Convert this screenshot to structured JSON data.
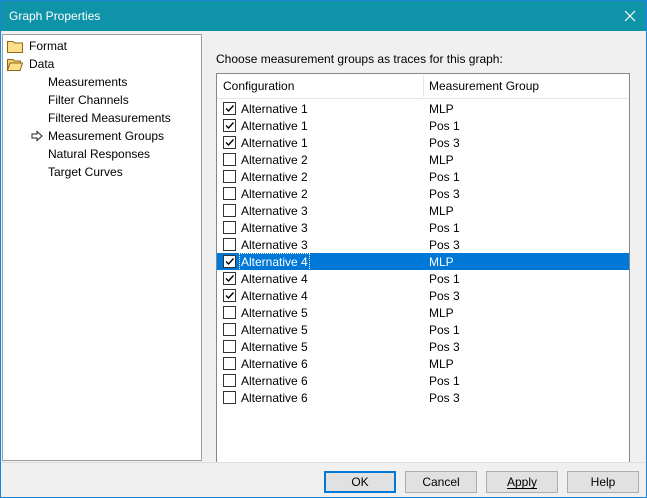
{
  "window": {
    "title": "Graph Properties"
  },
  "tree": {
    "items": [
      {
        "label": "Format",
        "icon": "folder-icon",
        "level": 0
      },
      {
        "label": "Data",
        "icon": "folder-open-icon",
        "level": 0
      },
      {
        "label": "Measurements",
        "level": 1
      },
      {
        "label": "Filter Channels",
        "level": 1
      },
      {
        "label": "Filtered Measurements",
        "level": 1
      },
      {
        "label": "Measurement Groups",
        "level": 1,
        "selected": true
      },
      {
        "label": "Natural Responses",
        "level": 1
      },
      {
        "label": "Target Curves",
        "level": 1
      }
    ]
  },
  "panel": {
    "prompt": "Choose measurement groups as traces for this graph:",
    "columns": [
      "Configuration",
      "Measurement Group"
    ],
    "rows": [
      {
        "config": "Alternative 1",
        "group": "MLP",
        "checked": true
      },
      {
        "config": "Alternative 1",
        "group": "Pos 1",
        "checked": true
      },
      {
        "config": "Alternative 1",
        "group": "Pos 3",
        "checked": true
      },
      {
        "config": "Alternative 2",
        "group": "MLP",
        "checked": false
      },
      {
        "config": "Alternative 2",
        "group": "Pos 1",
        "checked": false
      },
      {
        "config": "Alternative 2",
        "group": "Pos 3",
        "checked": false
      },
      {
        "config": "Alternative 3",
        "group": "MLP",
        "checked": false
      },
      {
        "config": "Alternative 3",
        "group": "Pos 1",
        "checked": false
      },
      {
        "config": "Alternative 3",
        "group": "Pos 3",
        "checked": false
      },
      {
        "config": "Alternative 4",
        "group": "MLP",
        "checked": true,
        "selected": true
      },
      {
        "config": "Alternative 4",
        "group": "Pos 1",
        "checked": true
      },
      {
        "config": "Alternative 4",
        "group": "Pos 3",
        "checked": true
      },
      {
        "config": "Alternative 5",
        "group": "MLP",
        "checked": false
      },
      {
        "config": "Alternative 5",
        "group": "Pos 1",
        "checked": false
      },
      {
        "config": "Alternative 5",
        "group": "Pos 3",
        "checked": false
      },
      {
        "config": "Alternative 6",
        "group": "MLP",
        "checked": false
      },
      {
        "config": "Alternative 6",
        "group": "Pos 1",
        "checked": false
      },
      {
        "config": "Alternative 6",
        "group": "Pos 3",
        "checked": false
      }
    ]
  },
  "buttons": {
    "ok": "OK",
    "cancel": "Cancel",
    "apply": "Apply",
    "help": "Help"
  },
  "colors": {
    "titlebar": "#0f93a8",
    "selection": "#0078d7"
  }
}
